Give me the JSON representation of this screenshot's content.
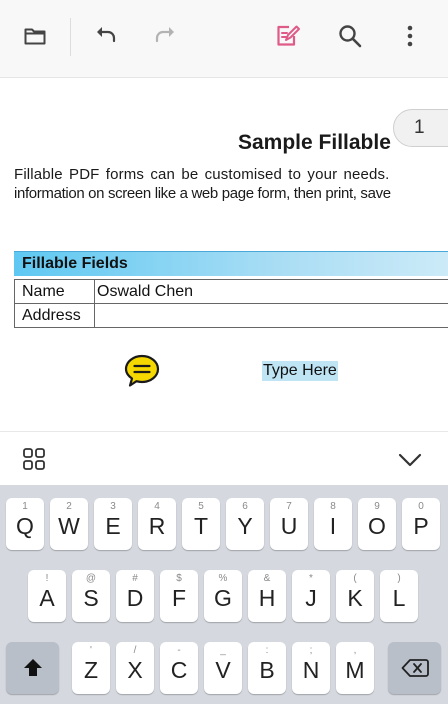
{
  "toolbar": {
    "icons": [
      "folder-icon",
      "undo-icon",
      "redo-icon",
      "form-edit-icon",
      "search-icon",
      "more-vert-icon"
    ],
    "accent_color": "#e05a88"
  },
  "document": {
    "title": "Sample Fillable",
    "page_number": "1",
    "paragraph": [
      "Fillable PDF forms can be customised to your needs.",
      "information on screen like a web page form, then print, save"
    ],
    "fields_header": "Fillable Fields",
    "fields": [
      {
        "label": "Name",
        "value": "Oswald Chen"
      },
      {
        "label": "Address",
        "value": ""
      }
    ],
    "annotation_icon": "comment-note-icon",
    "text_box": "Type Here"
  },
  "keyboard": {
    "row1": [
      {
        "hint": "1",
        "key": "Q"
      },
      {
        "hint": "2",
        "key": "W"
      },
      {
        "hint": "3",
        "key": "E"
      },
      {
        "hint": "4",
        "key": "R"
      },
      {
        "hint": "5",
        "key": "T"
      },
      {
        "hint": "6",
        "key": "Y"
      },
      {
        "hint": "7",
        "key": "U"
      },
      {
        "hint": "8",
        "key": "I"
      },
      {
        "hint": "9",
        "key": "O"
      },
      {
        "hint": "0",
        "key": "P"
      }
    ],
    "row2": [
      {
        "hint": "!",
        "key": "A"
      },
      {
        "hint": "@",
        "key": "S"
      },
      {
        "hint": "#",
        "key": "D"
      },
      {
        "hint": "$",
        "key": "F"
      },
      {
        "hint": "%",
        "key": "G"
      },
      {
        "hint": "&",
        "key": "H"
      },
      {
        "hint": "*",
        "key": "J"
      },
      {
        "hint": "(",
        "key": "K"
      },
      {
        "hint": ")",
        "key": "L"
      }
    ],
    "row3": [
      {
        "hint": "'",
        "key": "Z"
      },
      {
        "hint": "/",
        "key": "X"
      },
      {
        "hint": "-",
        "key": "C"
      },
      {
        "hint": "_",
        "key": "V"
      },
      {
        "hint": ":",
        "key": "B"
      },
      {
        "hint": ";",
        "key": "N"
      },
      {
        "hint": ",",
        "key": "M"
      }
    ]
  }
}
